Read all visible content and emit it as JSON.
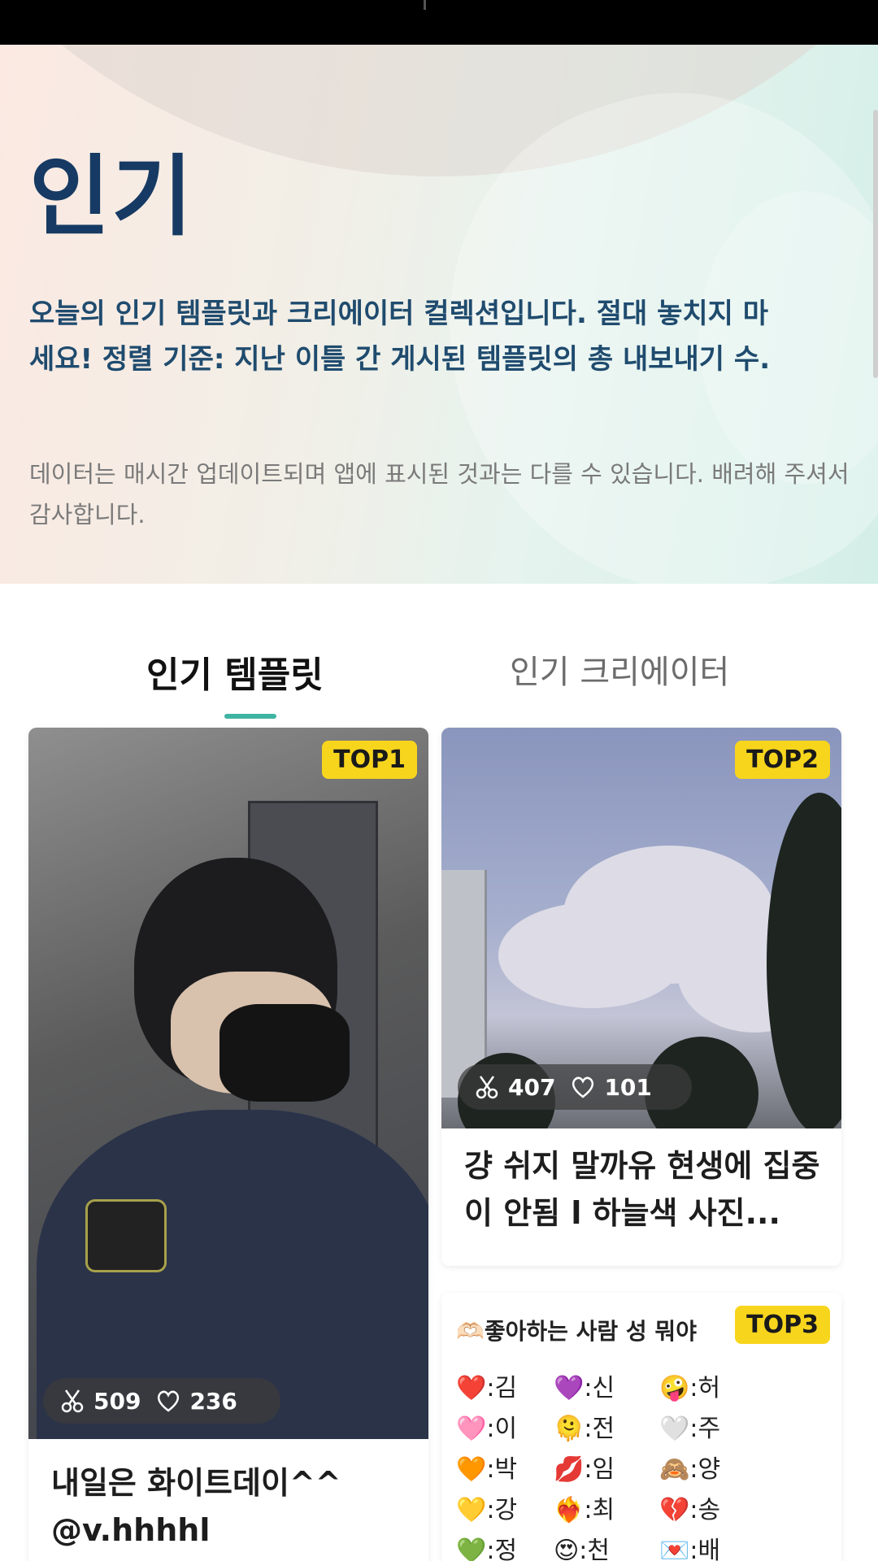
{
  "hero": {
    "title": "인기",
    "description": "오늘의 인기 템플릿과 크리에이터 컬렉션입니다. 절대 놓치지 마세요! 정렬 기준: 지난 이틀 간 게시된 템플릿의 총 내보내기 수.",
    "note": "데이터는 매시간 업데이트되며 앱에 표시된 것과는 다를 수 있습니다. 배려해 주셔서 감사합니다."
  },
  "tabs": {
    "active": "인기 템플릿",
    "inactive": "인기 크리에이터"
  },
  "cards": [
    {
      "badge": "TOP1",
      "uses": "509",
      "likes": "236",
      "title": "내일은 화이트데이^^ @v.hhhhl"
    },
    {
      "badge": "TOP2",
      "uses": "407",
      "likes": "101",
      "title": "걍 쉬지 말까유 현생에 집중이 안됨 l 하늘색 사진..."
    },
    {
      "badge": "TOP3",
      "list_title": "🫶🏻좋아하는 사람 성 뭐야",
      "items": [
        {
          "emoji": "❤️",
          "text": ":김"
        },
        {
          "emoji": "💜",
          "text": ":신"
        },
        {
          "emoji": "🤪",
          "text": ":허"
        },
        {
          "emoji": "🩷",
          "text": ":이"
        },
        {
          "emoji": "🫠",
          "text": ":전"
        },
        {
          "emoji": "🤍",
          "text": ":주"
        },
        {
          "emoji": "🧡",
          "text": ":박"
        },
        {
          "emoji": "💋",
          "text": ":임"
        },
        {
          "emoji": "🙈",
          "text": ":양"
        },
        {
          "emoji": "💛",
          "text": ":강"
        },
        {
          "emoji": "❤️‍🔥",
          "text": ":최"
        },
        {
          "emoji": "💔",
          "text": ":송"
        },
        {
          "emoji": "💚",
          "text": ":정"
        },
        {
          "emoji": "😍",
          "text": ":천"
        },
        {
          "emoji": "💌",
          "text": ":배"
        }
      ]
    }
  ],
  "colors": {
    "accent": "#3fb4a2",
    "badge": "#f7d51d",
    "title": "#163a63"
  }
}
